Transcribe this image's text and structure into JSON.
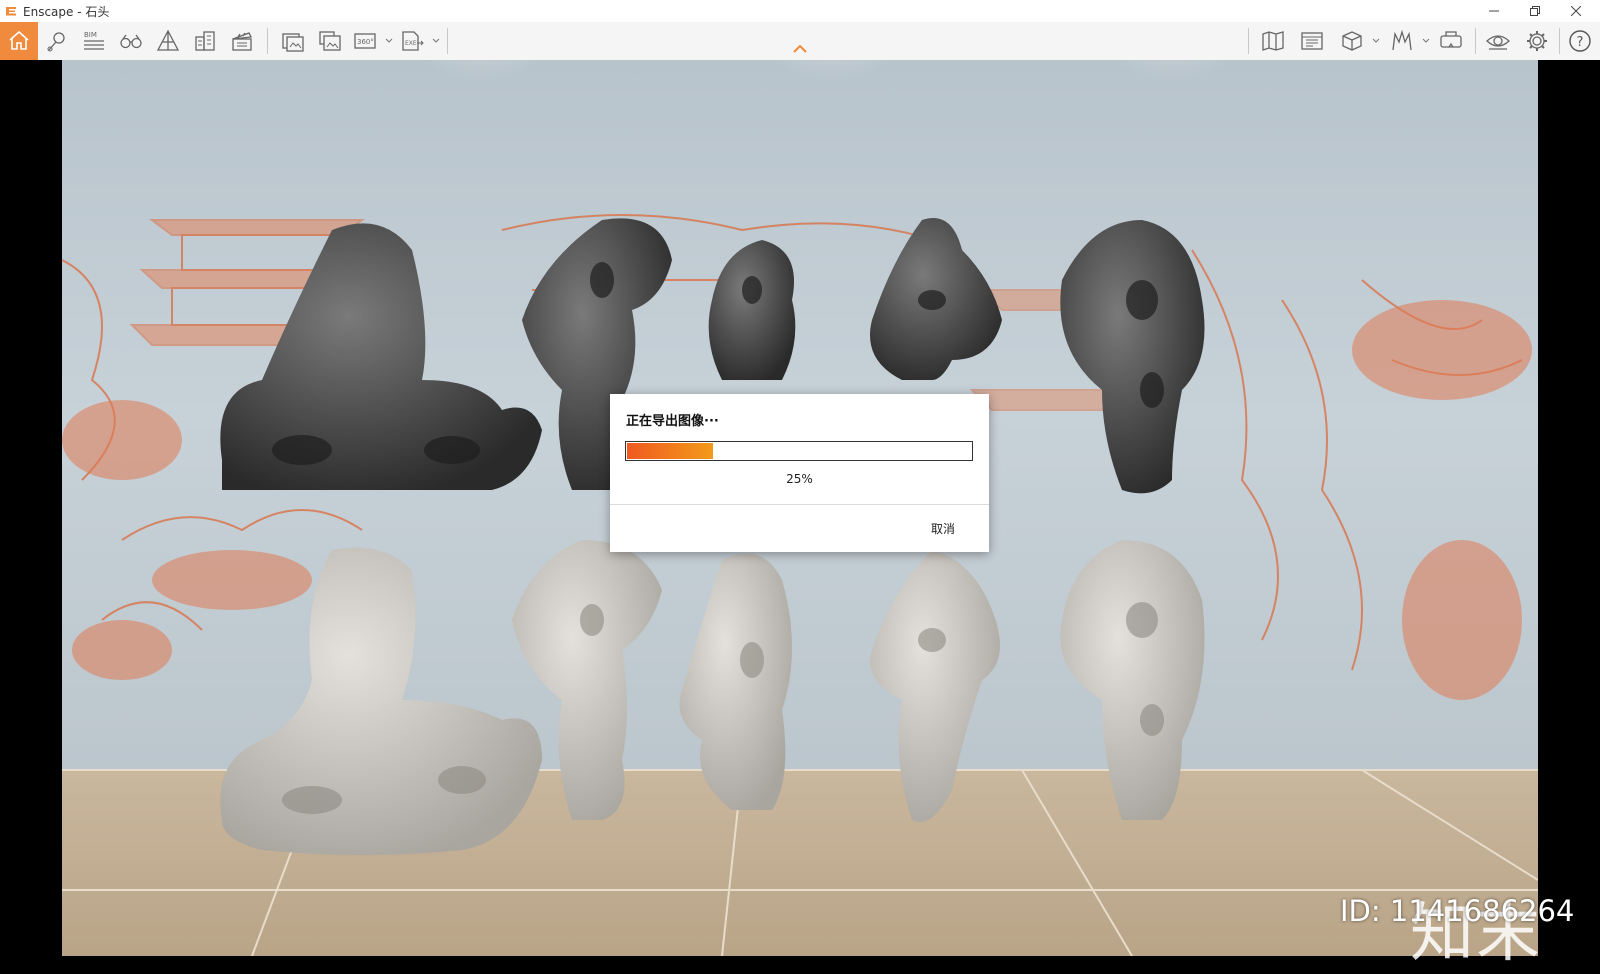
{
  "window": {
    "title": "Enscape - 石头",
    "accent_color": "#f08a3c",
    "controls": [
      "minimize-icon",
      "restore-icon",
      "close-icon"
    ]
  },
  "toolbar": {
    "left_icons": [
      "home-icon",
      "location-pin-icon",
      "bim-icon",
      "binoculars-icon",
      "perspective-icon",
      "buildings-icon",
      "clapper-icon",
      "screenshot-export-icon",
      "batch-export-icon",
      "panorama-360-icon",
      "exe-export-icon"
    ],
    "bim_label": "BIM",
    "pano_label": "360°",
    "exe_label": "EXE",
    "right_icons": [
      "map-icon",
      "asset-library-icon",
      "cube-view-icon",
      "material-icon",
      "vr-headset-icon",
      "visual-settings-icon",
      "settings-gear-icon",
      "help-icon"
    ],
    "help_label": "?"
  },
  "dialog": {
    "title": "正在导出图像···",
    "progress_percent": 25,
    "progress_label": "25%",
    "cancel_label": "取消"
  },
  "watermark": {
    "logo_text": "知末",
    "id_text": "ID: 1141686264"
  }
}
